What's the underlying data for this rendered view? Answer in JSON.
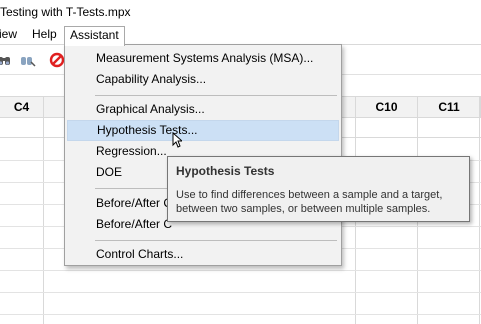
{
  "window": {
    "title": "Testing with T-Tests.mpx"
  },
  "menubar": {
    "items": [
      {
        "label": "iew"
      },
      {
        "label": "Help"
      },
      {
        "label": "Assistant"
      }
    ]
  },
  "columns": [
    "C4",
    "C10",
    "C11"
  ],
  "assistant_menu": {
    "items": [
      {
        "label": "Measurement Systems Analysis (MSA)..."
      },
      {
        "label": "Capability Analysis..."
      },
      {
        "label": "Graphical Analysis..."
      },
      {
        "label": "Hypothesis Tests..."
      },
      {
        "label": "Regression..."
      },
      {
        "label": "DOE"
      },
      {
        "label": "Before/After C"
      },
      {
        "label": "Before/After C"
      },
      {
        "label": "Control Charts..."
      }
    ]
  },
  "tooltip": {
    "title": "Hypothesis Tests",
    "body": "Use to find differences between a sample and a target, between two samples, or between multiple samples."
  },
  "colors": {
    "highlight": "#cce0f5",
    "stop_icon": "#e02020",
    "menu_bg": "#f2f2f2"
  },
  "icons": [
    "binoculars-icon",
    "find-replace-icon",
    "stop-icon",
    "cursor-icon"
  ]
}
